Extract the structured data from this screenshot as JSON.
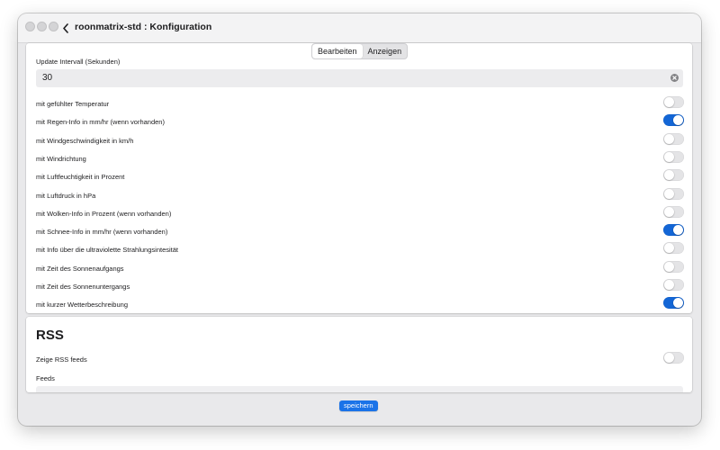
{
  "window": {
    "title": "roonmatrix-std : Konfiguration"
  },
  "tabs": [
    {
      "label": "Bearbeiten",
      "active": true
    },
    {
      "label": "Anzeigen",
      "active": false
    }
  ],
  "interval": {
    "label": "Update Intervall (Sekunden)",
    "value": "30"
  },
  "options": [
    {
      "label": "mit gefühlter Temperatur",
      "enabled": false
    },
    {
      "label": "mit Regen-Info in mm/hr (wenn vorhanden)",
      "enabled": true
    },
    {
      "label": "mit Windgeschwindigkeit in km/h",
      "enabled": false
    },
    {
      "label": "mit Windrichtung",
      "enabled": false
    },
    {
      "label": "mit Luftfeuchtigkeit in Prozent",
      "enabled": false
    },
    {
      "label": "mit Luftdruck in hPa",
      "enabled": false
    },
    {
      "label": "mit Wolken-Info in Prozent (wenn vorhanden)",
      "enabled": false
    },
    {
      "label": "mit Schnee-Info in mm/hr (wenn vorhanden)",
      "enabled": true
    },
    {
      "label": "mit Info über die ultraviolette Strahlungsintesität",
      "enabled": false
    },
    {
      "label": "mit Zeit des Sonnenaufgangs",
      "enabled": false
    },
    {
      "label": "mit Zeit des Sonnenuntergangs",
      "enabled": false
    },
    {
      "label": "mit kurzer Wetterbeschreibung",
      "enabled": true
    }
  ],
  "rss": {
    "title": "RSS",
    "show_label": "Zeige RSS feeds",
    "show_enabled": false,
    "feeds_label": "Feeds"
  },
  "footer": {
    "save_label": "speichern"
  },
  "colors": {
    "accent": "#1366d6",
    "toggle_off": "#e4e4e6",
    "button": "#1a73e8"
  }
}
